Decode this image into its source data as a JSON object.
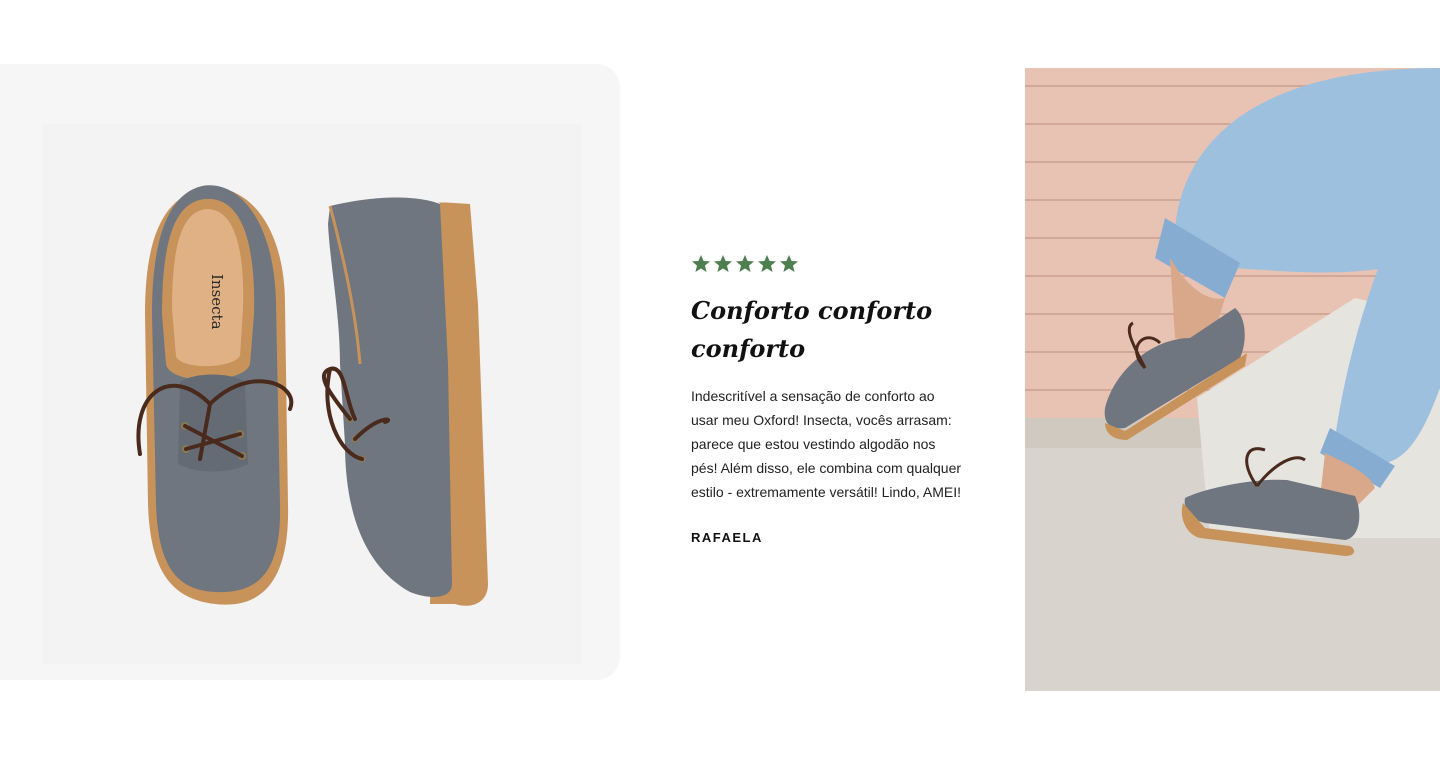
{
  "review": {
    "rating": 5,
    "rating_max": 5,
    "title": "Conforto conforto conforto",
    "body": "Indescritível a sensação de conforto ao usar meu Oxford! Insecta, vocês arrasam: parece que estou vestindo algodão nos pés! Além disso, ele combina com qualquer estilo - extremamente versátil! Lindo, AMEI!",
    "author": "RAFAELA"
  },
  "product_image": {
    "insole_brand": "Insecta"
  },
  "colors": {
    "star": "#4f7f4f",
    "shoe_fabric": "#6f7680",
    "sole": "#c8935a",
    "laces": "#4a2a1c",
    "denim": "#9ec0df",
    "wall": "#e8c3b4"
  },
  "icons": {
    "rating_star": "star-icon"
  }
}
